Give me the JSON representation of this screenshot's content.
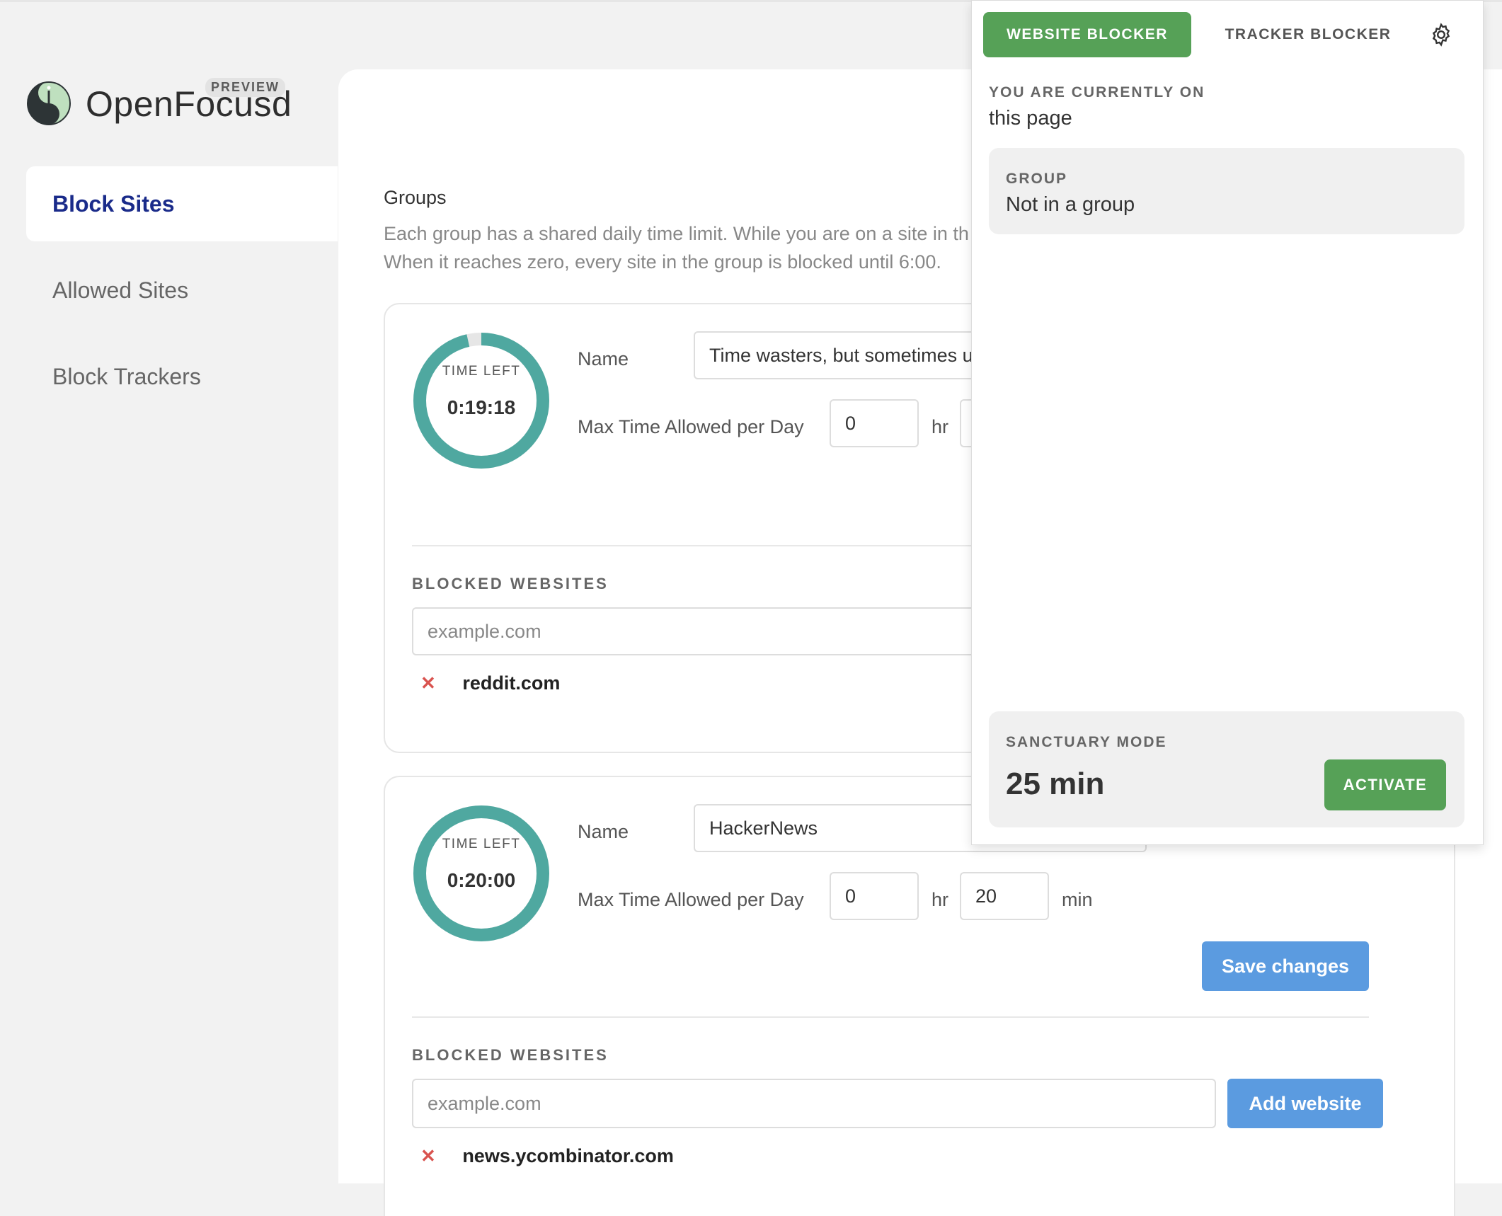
{
  "app": {
    "name": "OpenFocusd",
    "badge": "PREVIEW"
  },
  "sidebar": {
    "items": [
      {
        "label": "Block Sites",
        "active": true
      },
      {
        "label": "Allowed Sites",
        "active": false
      },
      {
        "label": "Block Trackers",
        "active": false
      }
    ]
  },
  "main": {
    "groups_title": "Groups",
    "groups_desc_line1": "Each group has a shared daily time limit. While you are on a site in th",
    "groups_desc_line2": "When it reaches zero, every site in the group is blocked until 6:00.",
    "groups": [
      {
        "ring_label": "TIME LEFT",
        "time_left": "0:19:18",
        "remaining_fraction": 0.965,
        "name_label": "Name",
        "name_value": "Time wasters, but sometimes u",
        "max_label": "Max Time Allowed per Day",
        "hours": "0",
        "hr_unit": "hr",
        "minutes": "",
        "min_unit": "",
        "blocked_label": "BLOCKED WEBSITES",
        "input_placeholder": "example.com",
        "sites": [
          "reddit.com"
        ]
      },
      {
        "ring_label": "TIME LEFT",
        "time_left": "0:20:00",
        "remaining_fraction": 1.0,
        "name_label": "Name",
        "name_value": "HackerNews",
        "max_label": "Max Time Allowed per Day",
        "hours": "0",
        "hr_unit": "hr",
        "minutes": "20",
        "min_unit": "min",
        "save_label": "Save changes",
        "blocked_label": "BLOCKED WEBSITES",
        "input_placeholder": "example.com",
        "add_label": "Add website",
        "sites": [
          "news.ycombinator.com"
        ]
      }
    ]
  },
  "popup": {
    "tab_website": "WEBSITE BLOCKER",
    "tab_tracker": "TRACKER BLOCKER",
    "current_label": "YOU ARE CURRENTLY ON",
    "current_value": "this page",
    "group_label": "GROUP",
    "group_value": "Not in a group",
    "sanctuary_label": "SANCTUARY MODE",
    "sanctuary_time": "25 min",
    "activate_label": "ACTIVATE"
  },
  "colors": {
    "accent_green": "#56a157",
    "ring_teal": "#4fa8a0",
    "ring_track": "#e6e6e6",
    "button_blue": "#5b9be0",
    "nav_active": "#1a2b8a",
    "remove_red": "#d9534f"
  },
  "icons": {
    "logo": "clock-yin-yang-icon",
    "settings": "gear-icon",
    "remove": "x-icon"
  }
}
